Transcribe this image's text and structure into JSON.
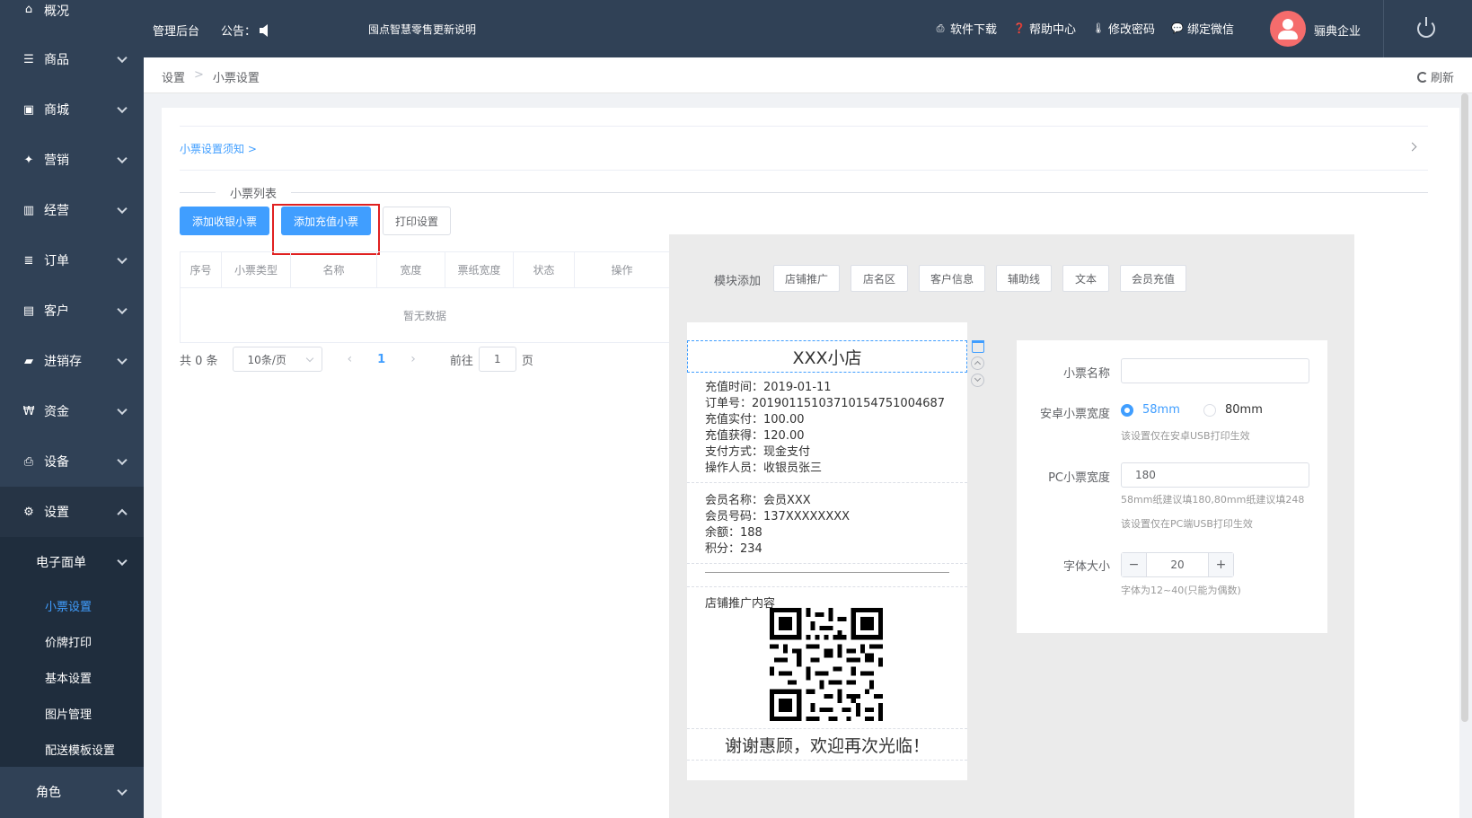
{
  "sidebar": {
    "items": [
      {
        "label": "概况"
      },
      {
        "label": "商品"
      },
      {
        "label": "商城"
      },
      {
        "label": "营销"
      },
      {
        "label": "经营"
      },
      {
        "label": "订单"
      },
      {
        "label": "客户"
      },
      {
        "label": "进销存"
      },
      {
        "label": "资金"
      },
      {
        "label": "设备"
      },
      {
        "label": "设置"
      }
    ],
    "submenu_head": "电子面单",
    "submenu": [
      {
        "label": "小票设置"
      },
      {
        "label": "价牌打印"
      },
      {
        "label": "基本设置"
      },
      {
        "label": "图片管理"
      },
      {
        "label": "配送模板设置"
      }
    ],
    "role": "角色"
  },
  "header": {
    "title": "管理后台",
    "notice_label": "公告：",
    "marquee": "囤点智慧零售更新说明",
    "links": [
      "软件下载",
      "帮助中心",
      "修改密码",
      "绑定微信"
    ],
    "company": "骊典企业"
  },
  "breadcrumb": {
    "root": "设置",
    "current": "小票设置",
    "refresh": "刷新"
  },
  "notice_link": "小票设置须知 >",
  "list_title": "小票列表",
  "buttons": {
    "add_cashier": "添加收银小票",
    "add_recharge": "添加充值小票",
    "print_settings": "打印设置"
  },
  "table": {
    "columns": [
      "序号",
      "小票类型",
      "名称",
      "宽度",
      "票纸宽度",
      "状态",
      "操作"
    ],
    "empty": "暂无数据"
  },
  "pager": {
    "total": "共 0 条",
    "size": "10条/页",
    "page": "1",
    "goto": "前往",
    "goto_value": "1",
    "page_unit": "页"
  },
  "modules": {
    "label": "模块添加",
    "items": [
      "店铺推广",
      "店名区",
      "客户信息",
      "辅助线",
      "文本",
      "会员充值"
    ]
  },
  "receipt": {
    "title": "XXX小店",
    "info": [
      "充值时间：2019-01-11",
      "订单号：20190115103710154751004687",
      "充值实付：100.00",
      "充值获得：120.00",
      "支付方式：现金支付",
      "操作人员：收银员张三"
    ],
    "member": [
      "会员名称：会员XXX",
      "会员号码：137XXXXXXXX",
      "余额：188",
      "积分：234"
    ],
    "promo_label": "店铺推广内容",
    "thanks": "谢谢惠顾，欢迎再次光临！"
  },
  "form": {
    "name_label": "小票名称",
    "name_value": "",
    "android_label": "安卓小票宽度",
    "android_options": [
      "58mm",
      "80mm"
    ],
    "android_hint": "该设置仅在安卓USB打印生效",
    "pc_label": "PC小票宽度",
    "pc_value": "180",
    "pc_hint1": "58mm纸建议填180,80mm纸建议填248",
    "pc_hint2": "该设置仅在PC端USB打印生效",
    "font_label": "字体大小",
    "font_value": "20",
    "font_hint": "字体为12~40(只能为偶数)"
  },
  "colors": {
    "sidebar": "#304156",
    "accent": "#409eff",
    "highlight": "#e02020",
    "avatar": "#f56c6c"
  }
}
